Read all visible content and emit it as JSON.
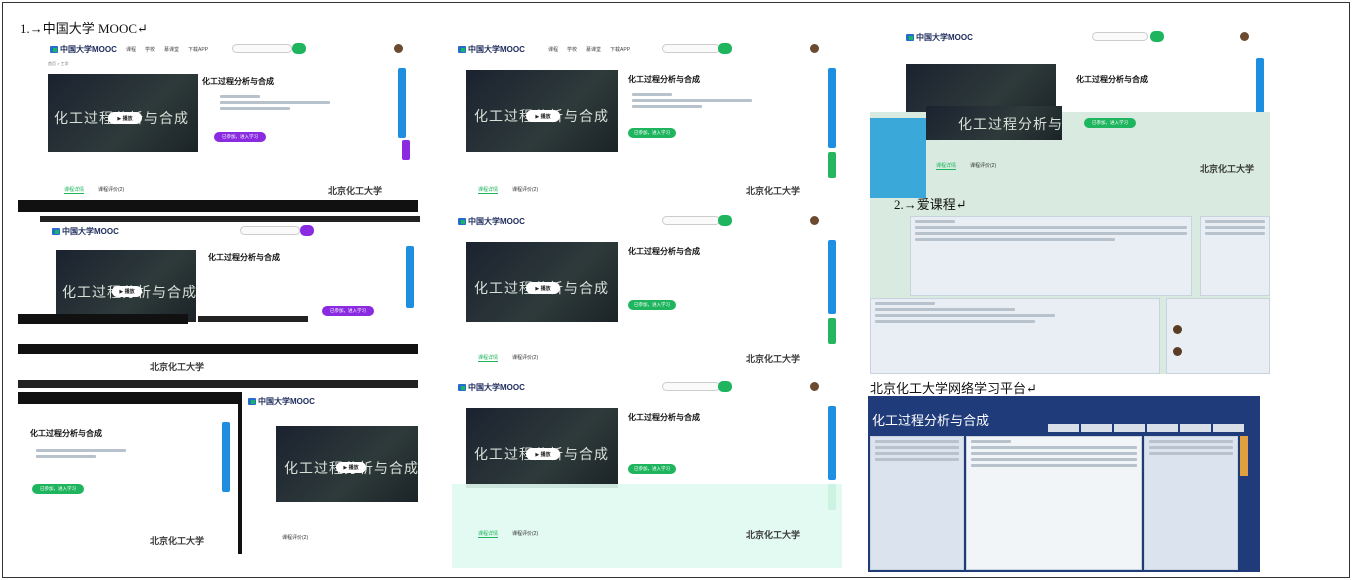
{
  "sections": {
    "s1_title": "1.→中国大学 MOOC↵",
    "s2_title": "2.→爱课程↵",
    "s3_title": "北京化工大学网络学习平台↵"
  },
  "mooc": {
    "logo_text": "中国大学MOOC",
    "course_title": "化工过程分析与合成",
    "video_text": "化工过程分析与合成",
    "play_label": "▶ 播放",
    "enroll_label": "已参加，进入学习",
    "tab_intro": "课程详情",
    "tab_review": "课程评价(2)",
    "univ_name": "北京化工大学",
    "breadcrumb": "首页 > 工学"
  },
  "icourse": {
    "video_text": "化工过程分析与合成",
    "enroll_label": "已参加，进入学习"
  },
  "bjut": {
    "banner_title": "化工过程分析与合成"
  },
  "colors": {
    "mooc_green": "#1fb55e",
    "mooc_purple": "#8a2be2",
    "sidebar_blue": "#1e8ee0",
    "bjut_navy": "#1f3b7a"
  }
}
